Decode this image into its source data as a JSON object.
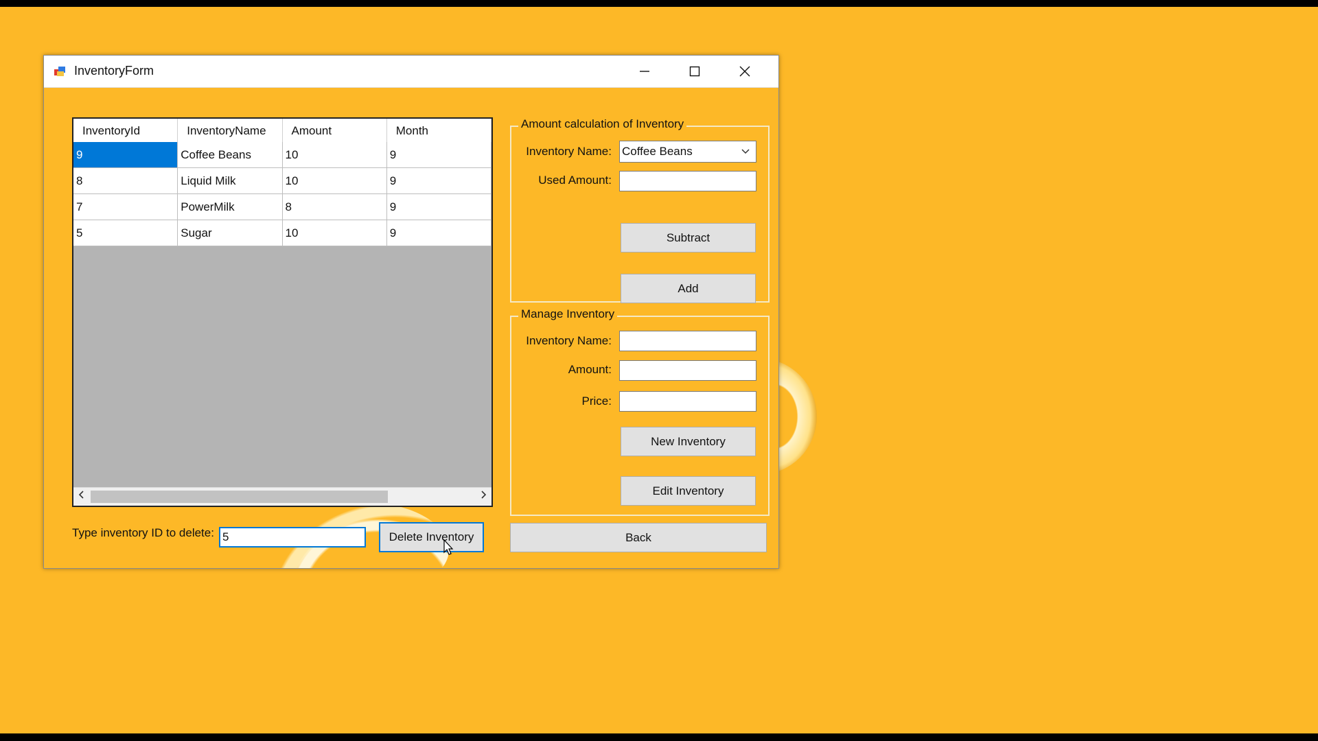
{
  "window": {
    "title": "InventoryForm",
    "minimize_glyph": "—",
    "maximize_glyph": "☐",
    "close_glyph": "✕"
  },
  "grid": {
    "columns": [
      "InventoryId",
      "InventoryName",
      "Amount",
      "Month"
    ],
    "rows": [
      {
        "id": "9",
        "name": "Coffee Beans",
        "amount": "10",
        "month": "9"
      },
      {
        "id": "8",
        "name": "Liquid Milk",
        "amount": "10",
        "month": "9"
      },
      {
        "id": "7",
        "name": "PowerMilk",
        "amount": "8",
        "month": "9"
      },
      {
        "id": "5",
        "name": "Sugar",
        "amount": "10",
        "month": "9"
      }
    ],
    "selected_row": 0,
    "scroll_left": "<",
    "scroll_right": ">"
  },
  "calc": {
    "legend": "Amount calculation of Inventory",
    "name_label": "Inventory Name:",
    "name_value": "Coffee Beans",
    "used_label": "Used Amount:",
    "used_value": "",
    "subtract_label": "Subtract",
    "add_label": "Add"
  },
  "manage": {
    "legend": "Manage Inventory",
    "name_label": "Inventory Name:",
    "name_value": "",
    "amount_label": "Amount:",
    "amount_value": "",
    "price_label": "Price:",
    "price_value": "",
    "new_label": "New Inventory",
    "edit_label": "Edit Inventory"
  },
  "delete": {
    "label": "Type inventory ID to delete:",
    "value": "5",
    "button_label": "Delete Inventory"
  },
  "back_label": "Back",
  "colors": {
    "background": "#FDB827",
    "selection": "#0078D7"
  }
}
